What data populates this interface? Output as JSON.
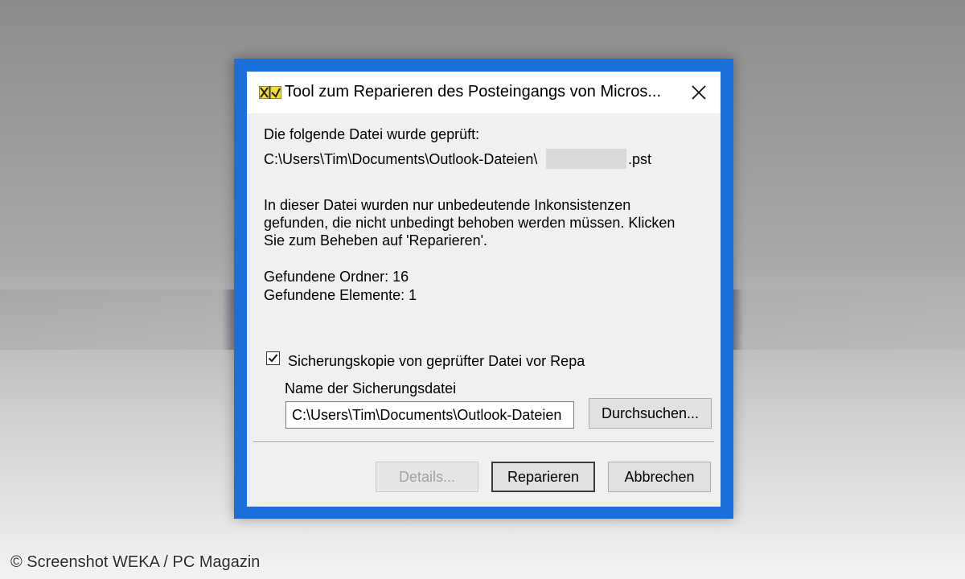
{
  "window": {
    "title": "Tool zum Reparieren des Posteingangs von Micros...",
    "icon": "inbox-repair-tool-icon",
    "close_icon": "close-icon"
  },
  "content": {
    "checked_file_label": "Die folgende Datei wurde geprüft:",
    "file_path_prefix": "C:\\Users\\Tim\\Documents\\Outlook-Dateien\\",
    "file_path_suffix": ".pst",
    "message_line1": "In dieser Datei wurden nur unbedeutende Inkonsistenzen",
    "message_line2": "gefunden, die nicht unbedingt behoben werden müssen. Klicken",
    "message_line3": "Sie zum Beheben auf 'Reparieren'.",
    "folders_found": "Gefundene Ordner: 16",
    "items_found": "Gefundene Elemente: 1"
  },
  "backup": {
    "checkbox_label": "Sicherungskopie von geprüfter Datei vor Repa",
    "checked": true,
    "name_label": "Name der Sicherungsdatei",
    "path_value": "C:\\Users\\Tim\\Documents\\Outlook-Dateien",
    "browse_label": "Durchsuchen..."
  },
  "buttons": {
    "details": "Details...",
    "repair": "Reparieren",
    "cancel": "Abbrechen"
  },
  "watermark": "© Screenshot WEKA / PC Magazin",
  "colors": {
    "window_border": "#1b6fd8",
    "dialog_background": "#f0f0f0"
  }
}
